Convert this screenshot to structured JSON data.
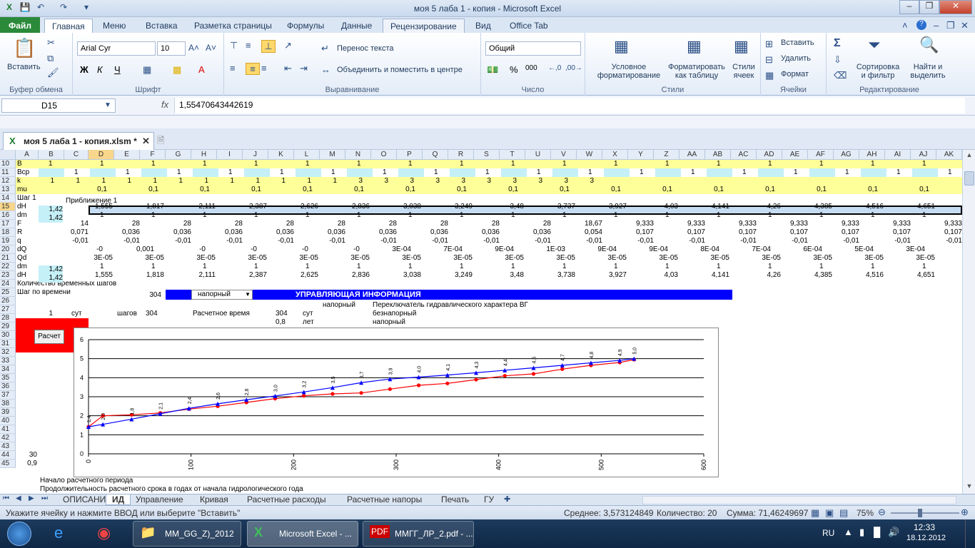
{
  "window": {
    "title": "моя 5 лаба 1 - копия  -  Microsoft Excel"
  },
  "ribbon_tabs": [
    "Файл",
    "Главная",
    "Меню",
    "Вставка",
    "Разметка страницы",
    "Формулы",
    "Данные",
    "Рецензирование",
    "Вид",
    "Office Tab"
  ],
  "ribbon": {
    "paste": "Вставить",
    "clipboard": "Буфер обмена",
    "font_name": "Arial Cyr",
    "font_size": "10",
    "font_group": "Шрифт",
    "wrap_text": "Перенос текста",
    "merge_center": "Объединить и поместить в центре",
    "align_group": "Выравнивание",
    "number_format": "Общий",
    "number_group": "Число",
    "cond_format": "Условное форматирование",
    "format_table": "Форматировать как таблицу",
    "cell_styles": "Стили ячеек",
    "styles_group": "Стили",
    "insert": "Вставить",
    "delete": "Удалить",
    "format": "Формат",
    "cells_group": "Ячейки",
    "sort_filter": "Сортировка и фильтр",
    "find_select": "Найти и выделить",
    "edit_group": "Редактирование",
    "bold": "Ж",
    "italic": "К",
    "underline": "Ч",
    "percent": "%",
    "thousands": "000"
  },
  "formula_bar": {
    "name_box": "D15",
    "fx": "fx",
    "value": "1,55470643442619"
  },
  "doc_tab": "моя 5 лаба 1 - копия.xlsm *",
  "columns": [
    "A",
    "B",
    "C",
    "D",
    "E",
    "F",
    "G",
    "H",
    "I",
    "J",
    "K",
    "L",
    "M",
    "N",
    "O",
    "P",
    "Q",
    "R",
    "S",
    "T",
    "U",
    "V",
    "W",
    "X",
    "Y",
    "Z",
    "AA",
    "AB",
    "AC",
    "AD",
    "AE",
    "AF",
    "AG",
    "AH",
    "AI",
    "AJ",
    "AK"
  ],
  "rows": [
    {
      "n": "10",
      "a": "B"
    },
    {
      "n": "11",
      "a": "Bcp"
    },
    {
      "n": "12",
      "a": "k"
    },
    {
      "n": "13",
      "a": "mu"
    },
    {
      "n": "14",
      "a": "Шаг 1"
    },
    {
      "n": "15",
      "a": "dH"
    },
    {
      "n": "16",
      "a": "dm"
    },
    {
      "n": "17",
      "a": "F"
    },
    {
      "n": "18",
      "a": "R"
    },
    {
      "n": "19",
      "a": "q"
    },
    {
      "n": "20",
      "a": "dQ"
    },
    {
      "n": "21",
      "a": "Qd"
    },
    {
      "n": "22",
      "a": "dm"
    },
    {
      "n": "23",
      "a": "dH"
    },
    {
      "n": "24",
      "a": "Количество временных шагов"
    },
    {
      "n": "25",
      "a": "Шаг по времени"
    },
    {
      "n": "26",
      "a": ""
    },
    {
      "n": "27",
      "a": ""
    },
    {
      "n": "28",
      "a": ""
    },
    {
      "n": "29",
      "a": ""
    },
    {
      "n": "30",
      "a": ""
    },
    {
      "n": "31",
      "a": ""
    },
    {
      "n": "32",
      "a": ""
    },
    {
      "n": "33",
      "a": ""
    },
    {
      "n": "34",
      "a": ""
    },
    {
      "n": "35",
      "a": ""
    },
    {
      "n": "36",
      "a": ""
    },
    {
      "n": "37",
      "a": ""
    },
    {
      "n": "38",
      "a": ""
    },
    {
      "n": "39",
      "a": ""
    },
    {
      "n": "40",
      "a": ""
    },
    {
      "n": "41",
      "a": ""
    },
    {
      "n": "42",
      "a": ""
    },
    {
      "n": "43",
      "a": ""
    },
    {
      "n": "44",
      "a": "30"
    },
    {
      "n": "45",
      "a": "0,9"
    }
  ],
  "cells": {
    "approx": "Приближение 1",
    "b15": "1,42",
    "b16": "1,42",
    "b22": "1,42",
    "b23": "1,42",
    "row15_values": [
      "1,555",
      "1,817",
      "2,111",
      "2,387",
      "2,626",
      "2,836",
      "3,038",
      "3,249",
      "3,48",
      "3,737",
      "3,927",
      "4,03",
      "4,141",
      "4,26",
      "4,385",
      "4,516",
      "4,651"
    ],
    "row23_values": [
      "1,555",
      "1,818",
      "2,111",
      "2,387",
      "2,625",
      "2,836",
      "3,038",
      "3,249",
      "3,48",
      "3,738",
      "3,927",
      "4,03",
      "4,141",
      "4,26",
      "4,385",
      "4,516",
      "4,651"
    ],
    "row17_values": [
      "14",
      "28",
      "28",
      "28",
      "28",
      "28",
      "28",
      "28",
      "28",
      "28",
      "18,67",
      "9,333",
      "9,333",
      "9,333",
      "9,333",
      "9,333",
      "9,333",
      "9,333",
      "9,333"
    ],
    "row18_values": [
      "0,071",
      "0,036",
      "0,036",
      "0,036",
      "0,036",
      "0,036",
      "0,036",
      "0,036",
      "0,036",
      "0,036",
      "0,054",
      "0,107",
      "0,107",
      "0,107",
      "0,107",
      "0,107",
      "0,107",
      "0,107",
      "0,107"
    ],
    "row19_values": [
      "-0,01",
      "-0,01",
      "-0,01",
      "-0,01",
      "-0,01",
      "-0,01",
      "-0,01",
      "-0,01",
      "-0,01",
      "-0,01",
      "-0,01",
      "-0,01",
      "-0,01",
      "-0,01",
      "-0,01",
      "-0,01",
      "-0,01",
      "-0,01",
      "-0,01"
    ],
    "row20_values": [
      "-0",
      "0,001",
      "-0",
      "-0",
      "-0",
      "-0",
      "3E-04",
      "7E-04",
      "9E-04",
      "1E-03",
      "9E-04",
      "9E-04",
      "8E-04",
      "7E-04",
      "6E-04",
      "5E-04",
      "3E-04"
    ],
    "row21_values": [
      "3E-05",
      "3E-05",
      "3E-05",
      "3E-05",
      "3E-05",
      "3E-05",
      "3E-05",
      "3E-05",
      "3E-05",
      "3E-05",
      "3E-05",
      "3E-05",
      "3E-05",
      "3E-05",
      "3E-05",
      "3E-05",
      "3E-05"
    ],
    "row13_values": [
      "0,1",
      "0,1",
      "0,1",
      "0,1",
      "0,1",
      "0,1",
      "0,1",
      "0,1",
      "0,1",
      "0,1",
      "0,1",
      "0,1",
      "0,1",
      "0,1",
      "0,1",
      "0,1",
      "0,1"
    ],
    "row12_values": [
      "1",
      "1",
      "1",
      "1",
      "1",
      "1",
      "1",
      "1",
      "1",
      "1",
      "1",
      "1",
      "3",
      "3",
      "3",
      "3",
      "3",
      "3",
      "3",
      "3",
      "3",
      "3"
    ],
    "steps_count": "304",
    "dropdown": "напорный",
    "info_title": "УПРАВЛЯЮЩАЯ ИНФОРМАЦИЯ",
    "r25_type": "напорный",
    "r25_switch": "Переключатель гидравлического характера ВГ",
    "r26_one": "1",
    "r26_days": "сут",
    "r26_steps": "шагов",
    "r26_steps_n": "304",
    "r26_calc": "Расчетное время",
    "r26_calc_n": "304",
    "r26_calc_u": "сут",
    "r26_type": "безнапорный",
    "r27_n": "0,8",
    "r27_u": "лет",
    "r27_type": "напорный",
    "calc_button": "Расчет",
    "r44": "Начало расчетного периода",
    "r45": "Продолжительность расчетного срока в годах от начала гидрологического года"
  },
  "chart_data": {
    "type": "line",
    "xlim": [
      0,
      600
    ],
    "ylim": [
      0,
      6
    ],
    "x_ticks": [
      "0",
      "100",
      "200",
      "300",
      "400",
      "500",
      "600"
    ],
    "y_ticks": [
      "0",
      "1",
      "2",
      "3",
      "4",
      "5",
      "6"
    ],
    "series": [
      {
        "color": "#ff0000",
        "x": [
          0,
          14,
          42,
          70,
          98,
          126,
          154,
          182,
          210,
          238,
          266,
          294,
          322,
          350,
          378,
          406,
          434,
          462,
          490,
          518,
          532
        ],
        "y": [
          1.42,
          2.0,
          2.05,
          2.15,
          2.35,
          2.5,
          2.7,
          2.9,
          3.05,
          3.15,
          3.2,
          3.4,
          3.6,
          3.7,
          3.9,
          4.1,
          4.2,
          4.45,
          4.65,
          4.8,
          4.95
        ]
      },
      {
        "color": "#0000ff",
        "x": [
          0,
          14,
          42,
          70,
          98,
          126,
          154,
          182,
          210,
          238,
          266,
          294,
          322,
          350,
          378,
          406,
          434,
          462,
          490,
          518,
          532
        ],
        "y": [
          1.42,
          1.55,
          1.82,
          2.11,
          2.39,
          2.63,
          2.84,
          3.04,
          3.25,
          3.48,
          3.74,
          3.93,
          4.03,
          4.14,
          4.26,
          4.39,
          4.52,
          4.65,
          4.78,
          4.91,
          5.0
        ]
      }
    ],
    "point_labels": [
      "1,4",
      "2,0",
      "1,8",
      "2,1",
      "2,4",
      "2,6",
      "2,8",
      "3,0",
      "3,2",
      "3,5",
      "3,7",
      "3,9",
      "4,0",
      "4,1",
      "4,3",
      "4,4",
      "4,5",
      "4,7",
      "4,8",
      "4,9",
      "5,0"
    ]
  },
  "sheet_tabs": [
    "ОПИСАНИЕ",
    "ИД",
    "Управление",
    "Кривая",
    "Расчетные расходы",
    "Расчетные напоры",
    "Печать",
    "ГУ"
  ],
  "active_sheet": "ИД",
  "status": {
    "message": "Укажите ячейку и нажмите ВВОД или выберите \"Вставить\"",
    "average": "Среднее: 3,573124849",
    "count": "Количество: 20",
    "sum": "Сумма: 71,46249697",
    "zoom": "75%"
  },
  "taskbar": {
    "items": [
      "MM_GG_Z)_2012",
      "Microsoft Excel - ...",
      "ММГГ_ЛР_2.pdf - ..."
    ],
    "lang": "RU",
    "time": "12:33",
    "date": "18.12.2012"
  }
}
